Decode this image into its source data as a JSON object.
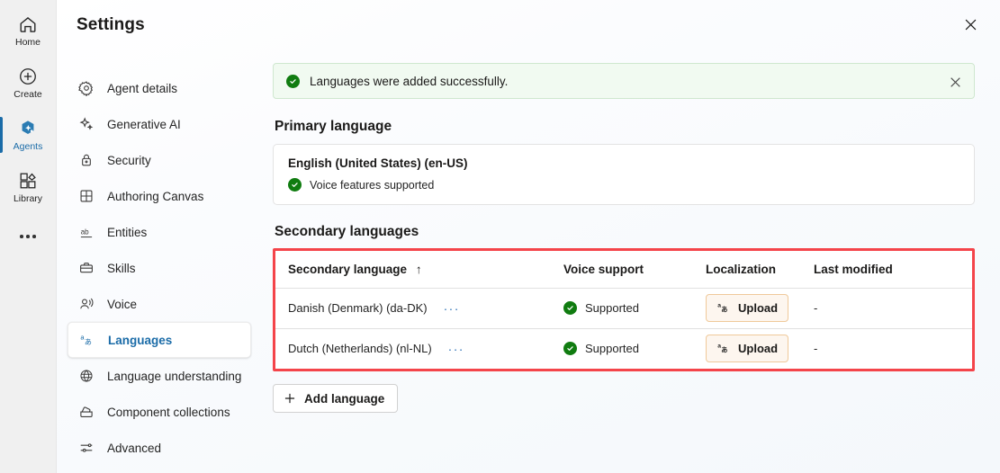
{
  "rail": {
    "items": [
      {
        "label": "Home",
        "icon": "home-icon",
        "active": false
      },
      {
        "label": "Create",
        "icon": "plus-circle-icon",
        "active": false
      },
      {
        "label": "Agents",
        "icon": "agents-icon",
        "active": true
      },
      {
        "label": "Library",
        "icon": "library-icon",
        "active": false
      }
    ],
    "overflow_label": "More"
  },
  "header": {
    "title": "Settings",
    "close_label": "Close"
  },
  "nav": {
    "items": [
      {
        "label": "Agent details",
        "icon": "gear-icon",
        "selected": false
      },
      {
        "label": "Generative AI",
        "icon": "sparkle-icon",
        "selected": false
      },
      {
        "label": "Security",
        "icon": "lock-icon",
        "selected": false
      },
      {
        "label": "Authoring Canvas",
        "icon": "grid-icon",
        "selected": false
      },
      {
        "label": "Entities",
        "icon": "ab-icon",
        "selected": false
      },
      {
        "label": "Skills",
        "icon": "briefcase-icon",
        "selected": false
      },
      {
        "label": "Voice",
        "icon": "voice-icon",
        "selected": false
      },
      {
        "label": "Languages",
        "icon": "translate-icon",
        "selected": true
      },
      {
        "label": "Language understanding",
        "icon": "globe-brain-icon",
        "selected": false
      },
      {
        "label": "Component collections",
        "icon": "collections-icon",
        "selected": false
      },
      {
        "label": "Advanced",
        "icon": "sliders-icon",
        "selected": false
      }
    ]
  },
  "banner": {
    "message": "Languages were added successfully.",
    "icon": "success-check-icon",
    "dismiss_label": "Dismiss"
  },
  "primary": {
    "section_title": "Primary language",
    "language": "English (United States) (en-US)",
    "voice_status": "Voice features supported"
  },
  "secondary": {
    "section_title": "Secondary languages",
    "columns": [
      {
        "label": "Secondary language",
        "sort": "↑"
      },
      {
        "label": "Voice support"
      },
      {
        "label": "Localization"
      },
      {
        "label": "Last modified"
      }
    ],
    "rows": [
      {
        "language": "Danish (Denmark) (da-DK)",
        "menu": "···",
        "voice_support": "Supported",
        "localization_button": "Upload",
        "last_modified": "-"
      },
      {
        "language": "Dutch (Netherlands) (nl-NL)",
        "menu": "···",
        "voice_support": "Supported",
        "localization_button": "Upload",
        "last_modified": "-"
      }
    ],
    "add_button": "Add language",
    "highlight_color": "#f4444a"
  },
  "colors": {
    "accent": "#1b6ca8",
    "success": "#107c10",
    "banner_bg": "#f1faf1",
    "upload_bg": "#fdf6ef",
    "upload_border": "#f0c99a",
    "highlight": "#f4444a"
  }
}
